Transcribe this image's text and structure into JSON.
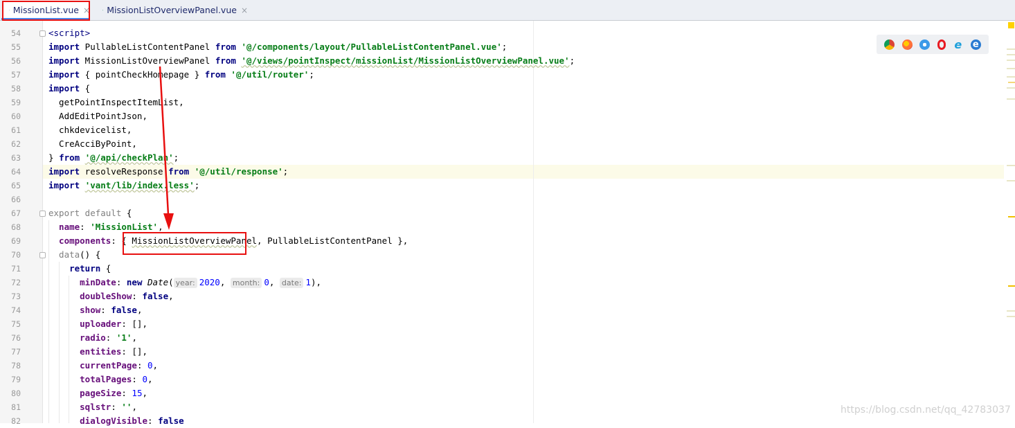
{
  "tabs": [
    {
      "label": "MissionList.vue",
      "active": true
    },
    {
      "label": "MissionListOverviewPanel.vue",
      "active": false
    }
  ],
  "close_glyph": "×",
  "line_numbers": [
    "54",
    "55",
    "56",
    "57",
    "58",
    "59",
    "60",
    "61",
    "62",
    "63",
    "64",
    "65",
    "66",
    "67",
    "68",
    "69",
    "70",
    "71",
    "72",
    "73",
    "74",
    "75",
    "76",
    "77",
    "78",
    "79",
    "80",
    "81",
    "82"
  ],
  "code": {
    "l54": "<script>",
    "l55_a": "import",
    "l55_b": " PullableListContentPanel ",
    "l55_c": "from",
    "l55_d": " ",
    "l55_e": "'@/components/layout/PullableListContentPanel.vue'",
    "l55_f": ";",
    "l56_a": "import",
    "l56_b": " MissionListOverviewPanel ",
    "l56_c": "from",
    "l56_d": " ",
    "l56_e": "'@/views/pointInspect/missionList/MissionListOverviewPanel.vue'",
    "l56_f": ";",
    "l57_a": "import",
    "l57_b": " { pointCheckHomepage } ",
    "l57_c": "from",
    "l57_d": " ",
    "l57_e": "'@/util/router'",
    "l57_f": ";",
    "l58_a": "import",
    "l58_b": " {",
    "l59": "  getPointInspectItemList,",
    "l60": "  AddEditPointJson,",
    "l61": "  chkdevicelist,",
    "l62": "  CreAcciByPoint,",
    "l63_a": "} ",
    "l63_b": "from",
    "l63_c": " ",
    "l63_d": "'@/api/checkPlan'",
    "l63_e": ";",
    "l64_a": "import",
    "l64_b": " resolveResponse ",
    "l64_c": "from",
    "l64_d": " ",
    "l64_e": "'@/util/response'",
    "l64_f": ";",
    "l65_a": "import",
    "l65_b": " ",
    "l65_c": "'vant/lib/index.less'",
    "l65_d": ";",
    "l66": "",
    "l67_a": "export default",
    "l67_b": " {",
    "l68_a": "  name",
    "l68_b": ": ",
    "l68_c": "'MissionList'",
    "l68_d": ",",
    "l69_a": "  components",
    "l69_b": ": { ",
    "l69_c": "MissionListOverviewPanel",
    "l69_d": ", PullableListContentPanel },",
    "l70_a": "  data",
    "l70_b": "() {",
    "l71_a": "    return",
    "l71_b": " {",
    "l72_a": "      minDate",
    "l72_b": ": ",
    "l72_c": "new",
    "l72_d": " ",
    "l72_e": "Date",
    "l72_f": "(",
    "l72_h1": "year:",
    "l72_v1": "2020",
    "l72_s1": ", ",
    "l72_h2": "month:",
    "l72_v2": "0",
    "l72_s2": ", ",
    "l72_h3": "date:",
    "l72_v3": "1",
    "l72_g": "),",
    "l73_a": "      doubleShow",
    "l73_b": ": ",
    "l73_c": "false",
    "l73_d": ",",
    "l74_a": "      show",
    "l74_b": ": ",
    "l74_c": "false",
    "l74_d": ",",
    "l75_a": "      uploader",
    "l75_b": ": [],",
    "l76_a": "      radio",
    "l76_b": ": ",
    "l76_c": "'1'",
    "l76_d": ",",
    "l77_a": "      entities",
    "l77_b": ": [],",
    "l78_a": "      currentPage",
    "l78_b": ": ",
    "l78_c": "0",
    "l78_d": ",",
    "l79_a": "      totalPages",
    "l79_b": ": ",
    "l79_c": "0",
    "l79_d": ",",
    "l80_a": "      pageSize",
    "l80_b": ": ",
    "l80_c": "15",
    "l80_d": ",",
    "l81_a": "      sqlstr",
    "l81_b": ": ",
    "l81_c": "''",
    "l81_d": ",",
    "l82_a": "      dialogVisible",
    "l82_b": ": ",
    "l82_c": "false"
  },
  "browsers": [
    "chrome-icon",
    "firefox-icon",
    "safari-icon",
    "opera-icon",
    "ie-icon",
    "edge-icon"
  ],
  "watermark": "https://blog.csdn.net/qq_42783037",
  "colors": {
    "annotation": "#e81010",
    "keyword": "#000080",
    "string": "#067d17"
  }
}
